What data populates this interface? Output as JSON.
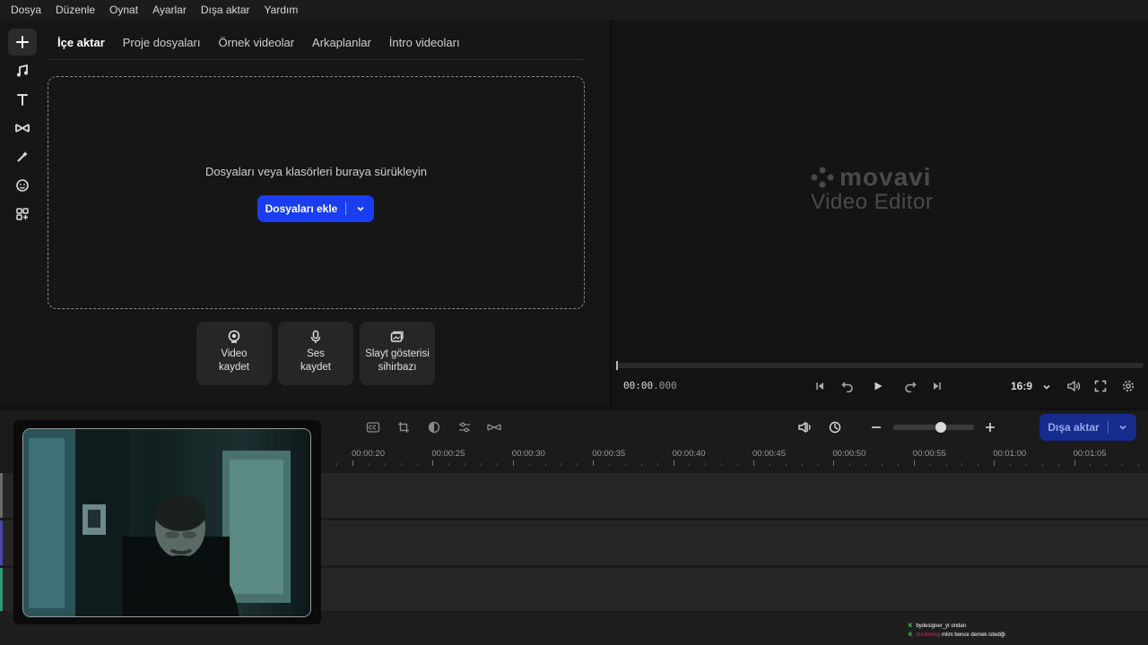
{
  "menu": [
    "Dosya",
    "Düzenle",
    "Oynat",
    "Ayarlar",
    "Dışa aktar",
    "Yardım"
  ],
  "rail_tools": [
    {
      "name": "import-add-icon"
    },
    {
      "name": "music-icon"
    },
    {
      "name": "titles-icon"
    },
    {
      "name": "transitions-icon"
    },
    {
      "name": "effects-icon"
    },
    {
      "name": "stickers-icon"
    },
    {
      "name": "more-tools-icon"
    }
  ],
  "import": {
    "tabs": [
      "İçe aktar",
      "Proje dosyaları",
      "Örnek videolar",
      "Arkaplanlar",
      "İntro videoları"
    ],
    "drop_hint": "Dosyaları veya klasörleri buraya sürükleyin",
    "add_files_label": "Dosyaları ekle",
    "cards": [
      {
        "label": "Video\nkaydet",
        "icon": "webcam-icon"
      },
      {
        "label": "Ses\nkaydet",
        "icon": "microphone-icon"
      },
      {
        "label": "Slayt gösterisi\nsihirbazı",
        "icon": "slideshow-icon"
      }
    ]
  },
  "preview": {
    "logo_word": "movavi",
    "logo_sub": "Video Editor",
    "timecode_main": "00:00",
    "timecode_ms": ".000",
    "aspect_ratio": "16:9"
  },
  "timeline": {
    "export_label": "Dışa aktar",
    "zoom_level": 0.6,
    "ruler_ticks": [
      "00:00:20",
      "00:00:25",
      "00:00:30",
      "00:00:35",
      "00:00:40",
      "00:00:45",
      "00:00:50",
      "00:00:55",
      "00:01:00",
      "00:01:05"
    ],
    "track_colors": [
      "#6a6a6a",
      "#4b46a8",
      "#2f9a74"
    ]
  },
  "chat": [
    {
      "user": "bydesigner_yt",
      "user_color": "#ffffff",
      "text": "ondan"
    },
    {
      "user": "durdenmg",
      "user_color": "#d6264f",
      "text": "mlim bence demek istediği"
    }
  ],
  "colors": {
    "accent": "#1a3df2",
    "export_button": "#172c8e",
    "background": "#161616"
  }
}
